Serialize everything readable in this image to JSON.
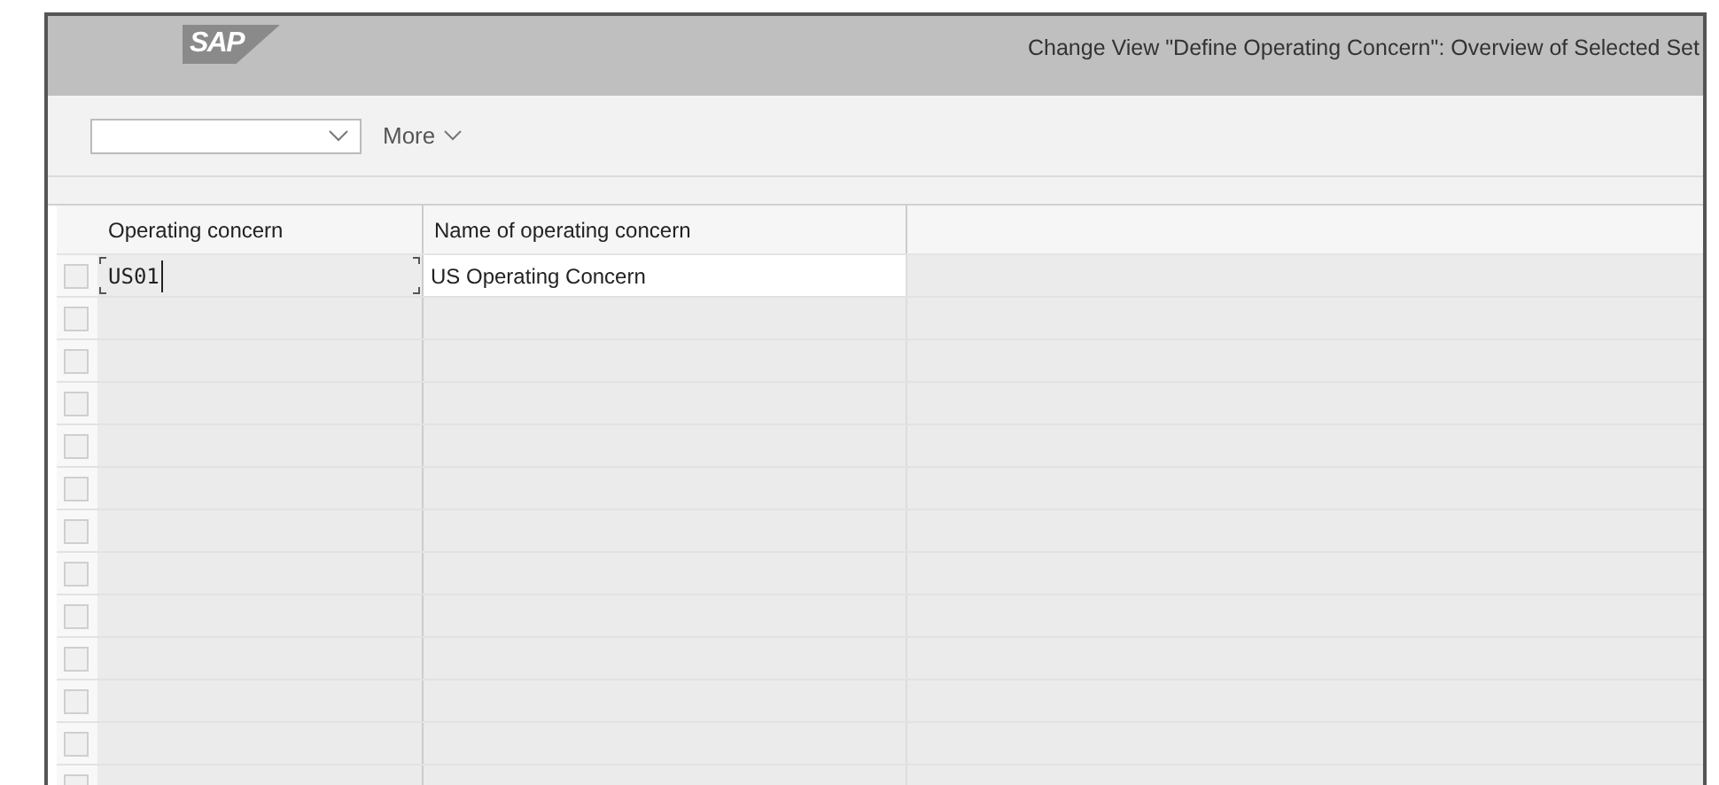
{
  "header": {
    "logo": "SAP",
    "title": "Change View \"Define Operating Concern\": Overview of Selected Set"
  },
  "toolbar": {
    "more_menu": "More"
  },
  "table": {
    "columns": [
      "Operating concern",
      "Name of operating concern"
    ],
    "rows": [
      {
        "operating_concern": "US01",
        "name": "US Operating Concern",
        "selected": false,
        "editing": true
      },
      {
        "selected": false,
        "editing": false
      },
      {
        "selected": false,
        "editing": false
      },
      {
        "selected": false,
        "editing": false
      },
      {
        "selected": false,
        "editing": false
      },
      {
        "selected": false,
        "editing": false
      },
      {
        "selected": false,
        "editing": false
      },
      {
        "selected": false,
        "editing": false
      },
      {
        "selected": false,
        "editing": false
      },
      {
        "selected": false,
        "editing": false
      },
      {
        "selected": false,
        "editing": false
      },
      {
        "selected": false,
        "editing": false
      },
      {
        "selected": false,
        "editing": false
      }
    ]
  }
}
